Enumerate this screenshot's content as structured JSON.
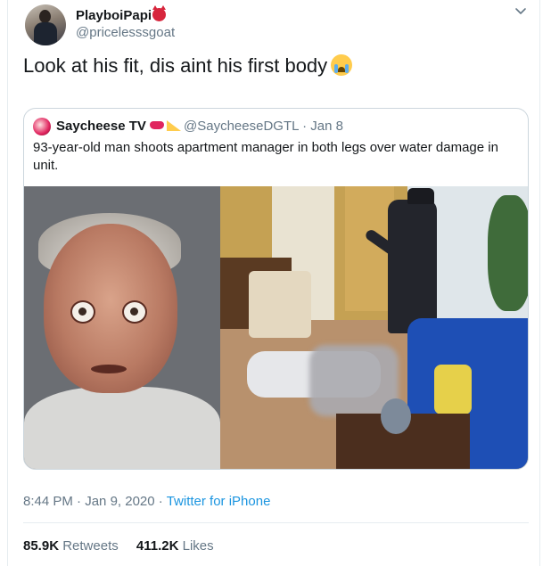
{
  "tweet": {
    "author": {
      "display_name": "PlayboiPapi",
      "handle": "@pricelesssgoat",
      "name_emoji": "devil-face-icon"
    },
    "text": "Look at his fit, dis aint his first body",
    "text_emoji": "loudly-crying-face-icon",
    "menu_icon": "chevron-down-icon"
  },
  "quoted": {
    "display_name": "Saycheese TV",
    "name_emojis": [
      "lips-icon",
      "cheese-icon"
    ],
    "handle": "@SaycheeseDGTL",
    "separator": "·",
    "date": "Jan 8",
    "text": "93-year-old man shoots apartment manager in both legs over water damage in unit.",
    "media": [
      "mugshot-photo",
      "surveillance-photo"
    ]
  },
  "meta": {
    "time": "8:44 PM",
    "sep1": "·",
    "date": "Jan 9, 2020",
    "sep2": "·",
    "source": "Twitter for iPhone"
  },
  "stats": {
    "retweets_count": "85.9K",
    "retweets_label": "Retweets",
    "likes_count": "411.2K",
    "likes_label": "Likes"
  },
  "colors": {
    "link": "#1b95e0",
    "secondary": "#657786",
    "border": "#ccd6dd",
    "text": "#14171a"
  }
}
